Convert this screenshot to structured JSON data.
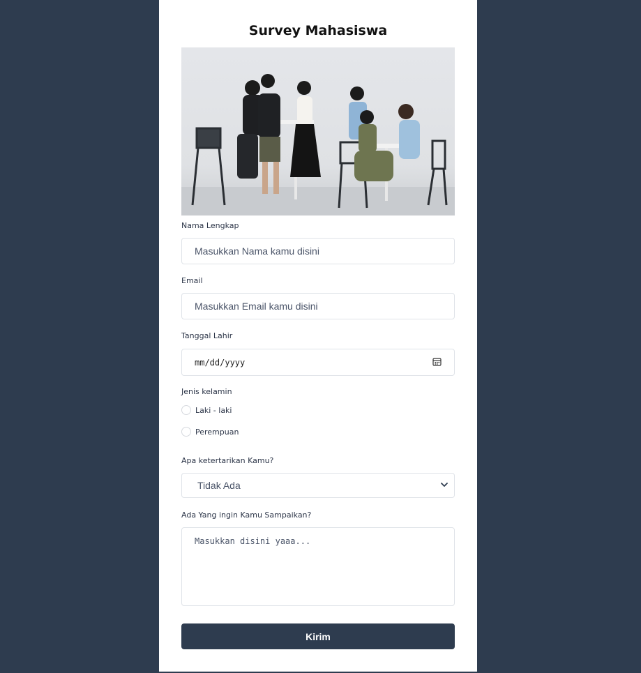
{
  "form": {
    "title": "Survey Mahasiswa",
    "name_label": "Nama Lengkap",
    "name_placeholder": "Masukkan Nama kamu disini",
    "email_label": "Email",
    "email_placeholder": "Masukkan Email kamu disini",
    "dob_label": "Tanggal Lahir",
    "dob_placeholder": "mm/dd/yyyy",
    "gender_label": "Jenis kelamin",
    "gender_options": [
      "Laki - laki",
      "Perempuan"
    ],
    "interest_label": "Apa ketertarikan Kamu?",
    "interest_selected": "Tidak Ada",
    "message_label": "Ada Yang ingin Kamu Sampaikan?",
    "message_placeholder": "Masukkan disini yaaa...",
    "submit_label": "Kirim"
  },
  "icons": {
    "calendar": "calendar-icon",
    "select_arrow": "chevron-down-icon"
  },
  "colors": {
    "background": "#2e3c4f",
    "card": "#ffffff",
    "button": "#2e3c4f",
    "button_text": "#ffffff"
  }
}
